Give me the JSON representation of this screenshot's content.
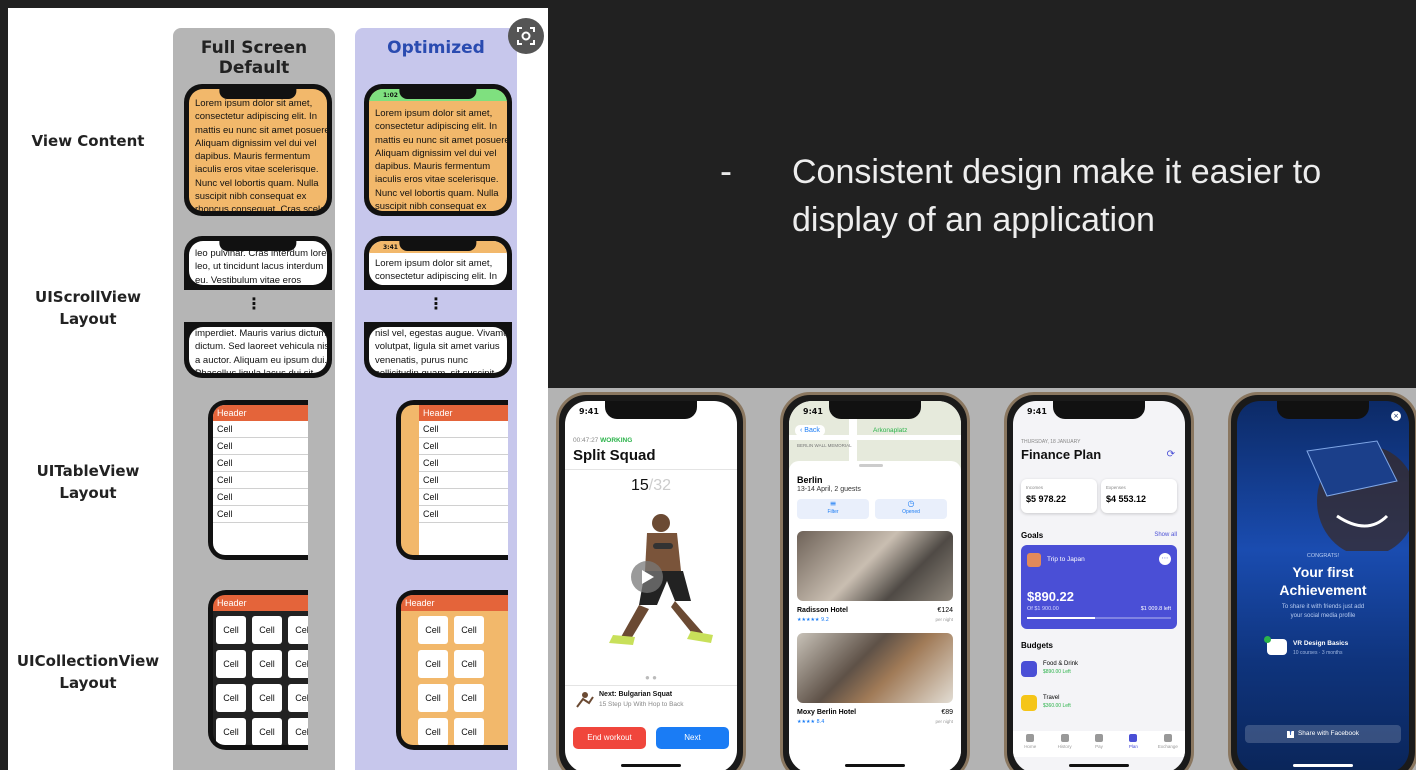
{
  "figure": {
    "col_default": "Full Screen Default",
    "col_optimized": "Optimized",
    "rows": {
      "view_content": "View Content",
      "scroll_line1": "UIScrollView",
      "scroll_line2": "Layout",
      "table_line1": "UITableView",
      "table_line2": "Layout",
      "collection_line1": "UICollectionView",
      "collection_line2": "Layout"
    },
    "status_time": "1:02",
    "status_time_scroll": "3:41",
    "lorem_lines": [
      "Lorem ipsum dolor sit amet,",
      "consectetur adipiscing elit. In",
      "mattis eu nunc sit amet posuere.",
      "Aliquam dignissim vel dui vel",
      "dapibus. Mauris fermentum",
      "iaculis eros vitae scelerisque.",
      "Nunc vel lobortis quam. Nulla",
      "suscipit nibh consequat ex",
      "rhoncus consequat. Cras sceler..."
    ],
    "scroll_default_top": [
      "leo pulvinar. Cras interdum lorem",
      "leo, ut tincidunt lacus interdum",
      "eu. Vestibulum vitae eros"
    ],
    "scroll_optimized_top": [
      "Lorem ipsum dolor sit amet,",
      "consectetur adipiscing elit. In"
    ],
    "scroll_default_bottom": [
      "imperdiet. Mauris varius dictum",
      "dictum. Sed laoreet vehicula nisl",
      "a auctor. Aliquam eu ipsum dui.",
      "Phasellus ligula lacus dui sit"
    ],
    "scroll_optimized_bottom": [
      "nisl vel, egestas augue. Vivamus",
      "volutpat, ligula sit amet varius",
      "venenatis, purus nunc",
      "sollicitudin quam, sit suscipit"
    ],
    "ellipsis": "⋮",
    "table_header": "Header",
    "cell": "Cell"
  },
  "bullet": {
    "marker": "-",
    "line1": "Consistent design make it easier to",
    "line2": "display of an application"
  },
  "phones": {
    "workout": {
      "time": "9:41",
      "timer": "00:47:27",
      "status": "WORKING",
      "title": "Split Squad",
      "count": "15",
      "total": "/32",
      "next_title": "Next: Bulgarian Squat",
      "next_sub": "15 Step Up With Hop to Back",
      "end_label": "End workout",
      "next_label": "Next",
      "end_color": "#f0463c",
      "next_color": "#1a7cf5"
    },
    "hotel": {
      "time": "9:41",
      "back": "Back",
      "map_place": "Arkonaplatz",
      "memorial": "BERLIN WALL MEMORIAL",
      "city": "Berlin",
      "dates": "13-14 April, 2 guests",
      "filter": "Filter",
      "opened": "Opened",
      "hotel1": "Radisson Hotel",
      "price1": "€124",
      "rating1": "★★★★★ 9.2",
      "per_night": "per night",
      "hotel2": "Moxy Berlin Hotel",
      "price2": "€89",
      "rating2": "★★★★ 8.4"
    },
    "finance": {
      "time": "9:41",
      "date": "THURSDAY, 18 JANUARY",
      "title": "Finance Plan",
      "incomes_label": "Incomes",
      "incomes": "$5 978.22",
      "expenses_label": "Expenses",
      "expenses": "$4 553.12",
      "goals": "Goals",
      "show_all": "Show all",
      "goal_name": "Trip to Japan",
      "goal_amount": "$890.22",
      "goal_of": "Of $1 900.00",
      "goal_left": "$1 009.8 left",
      "goal_progress": 0.47,
      "budgets": "Budgets",
      "budget1": "Food & Drink",
      "budget1_left": "$890.00 Left",
      "budget2": "Travel",
      "budget2_left": "$360.00 Left",
      "tabs": [
        "Home",
        "History",
        "Pay",
        "Plan",
        "Exchange"
      ],
      "accent": "#4a4fd6"
    },
    "vr": {
      "congrats": "CONGRATS!",
      "title1": "Your first",
      "title2": "Achievement",
      "sub1": "To share it with friends just add",
      "sub2": "your social media profile",
      "course": "VR Design Basics",
      "course_sub": "10 courses · 3 months",
      "share": "Share with Facebook"
    }
  }
}
